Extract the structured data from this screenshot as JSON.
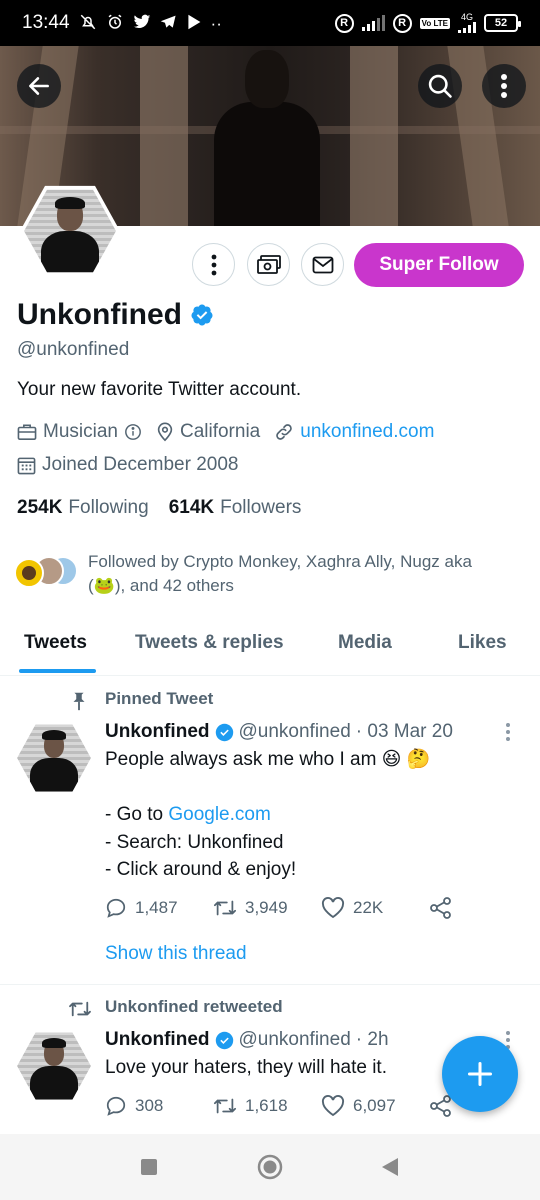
{
  "status_bar": {
    "time": "13:44",
    "network": "4G",
    "lte": "Vo LTE",
    "battery": "52",
    "registered_mark": "R"
  },
  "profile": {
    "display_name": "Unkonfined",
    "handle": "@unkonfined",
    "bio": "Your new favorite Twitter account.",
    "category": "Musician",
    "location": "California",
    "website": "unkonfined.com",
    "joined": "Joined December 2008",
    "following_count": "254K",
    "following_label": "Following",
    "followers_count": "614K",
    "followers_label": "Followers",
    "followed_by": "Followed by Crypto Monkey, Xaghra Ally, Nugz aka (🐸), and 42 others",
    "super_follow_label": "Super Follow",
    "accent_color": "#c936cc",
    "verified_color": "#1d9bf0"
  },
  "tabs": [
    "Tweets",
    "Tweets & replies",
    "Media",
    "Likes"
  ],
  "active_tab": "Tweets",
  "tweets": [
    {
      "label": "Pinned Tweet",
      "label_icon": "pin-icon",
      "name": "Unkonfined",
      "handle": "@unkonfined",
      "time": "· 03 Mar 20",
      "text_line1": "People always ask me who I am 😆 🤔",
      "text_go": "- Go to ",
      "text_link": "Google.com",
      "text_rest": "- Search: Unkonfined\n- Click around & enjoy!",
      "replies": "1,487",
      "retweets": "3,949",
      "likes": "22K",
      "show_thread": "Show this thread"
    },
    {
      "label": "Unkonfined retweeted",
      "label_icon": "retweet-icon",
      "name": "Unkonfined",
      "handle": "@unkonfined",
      "time": "· 2h",
      "text": "Love your haters, they will hate it.",
      "replies": "308",
      "retweets": "1,618",
      "likes": "6,097"
    }
  ]
}
